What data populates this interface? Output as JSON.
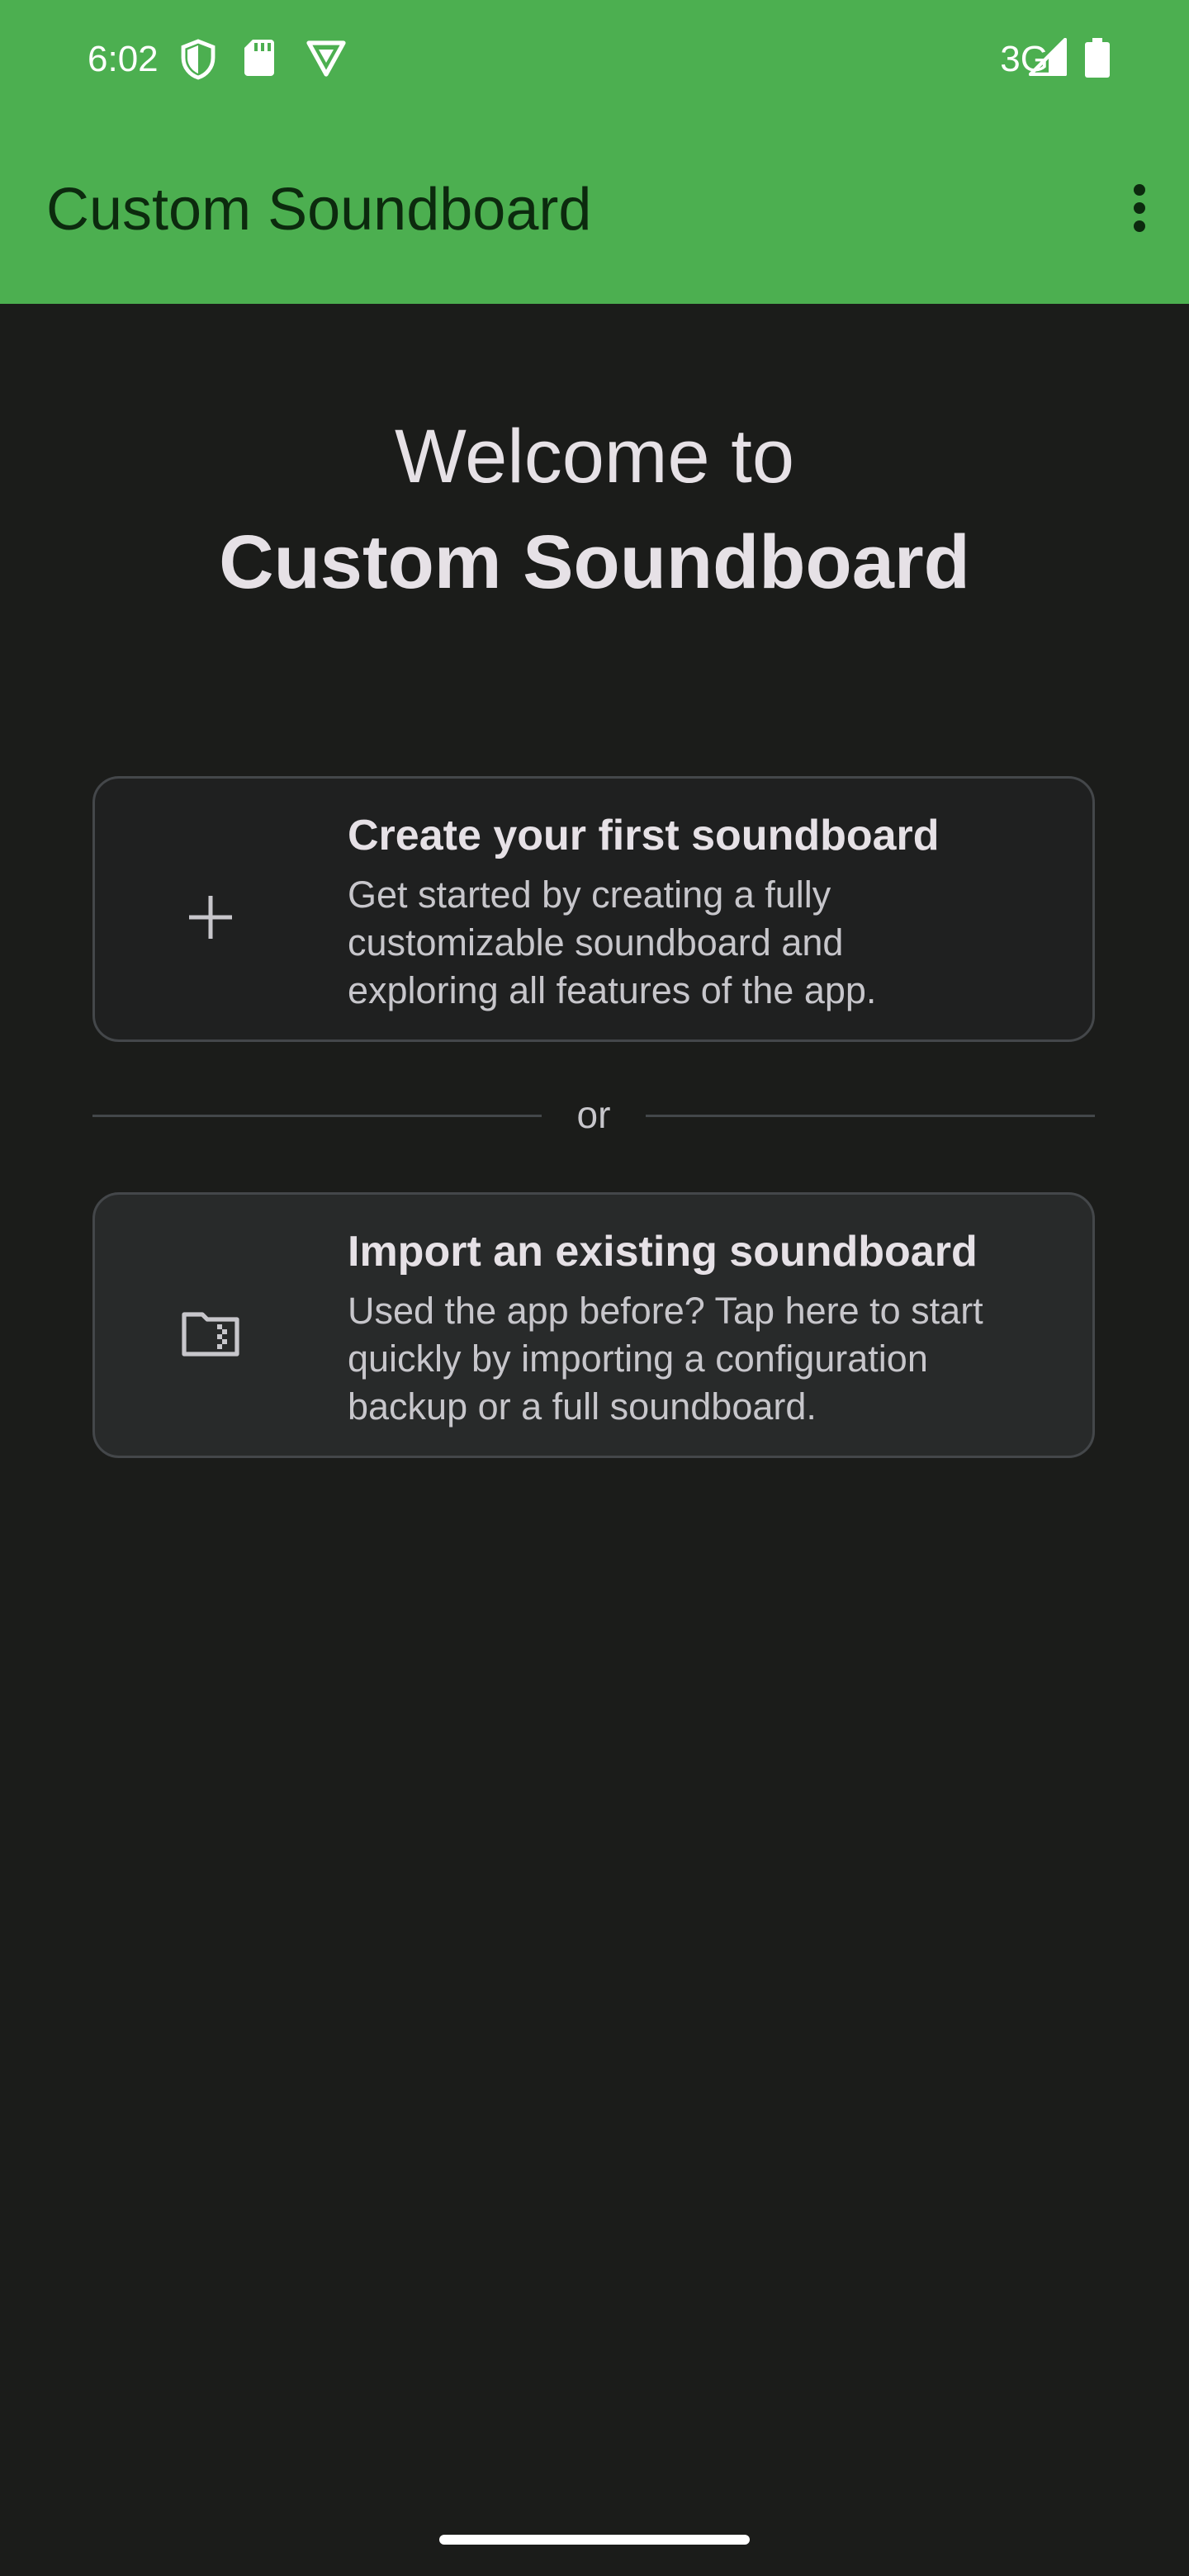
{
  "status_bar": {
    "time": "6:02",
    "network": "3G",
    "icons": [
      "shield-icon",
      "sd-card-icon",
      "vpn-badge-icon",
      "signal-icon",
      "battery-icon"
    ]
  },
  "app_bar": {
    "title": "Custom Soundboard",
    "menu_icon": "more-vert-icon"
  },
  "welcome": {
    "line1": "Welcome to",
    "line2": "Custom Soundboard"
  },
  "create_card": {
    "icon": "add-icon",
    "title": "Create your first soundboard",
    "description": "Get started by creating a fully\ncustomizable soundboard and\nexploring all features of the app."
  },
  "divider": {
    "text": "or"
  },
  "import_card": {
    "icon": "folder-icon",
    "title": "Import an existing soundboard",
    "description": "Used the app before? Tap here to start\nquickly by importing a configuration\nbackup or a full soundboard."
  },
  "colors": {
    "primary": "#4caf50",
    "background": "#1b1c1a",
    "on_primary": "#0c2a0e"
  }
}
